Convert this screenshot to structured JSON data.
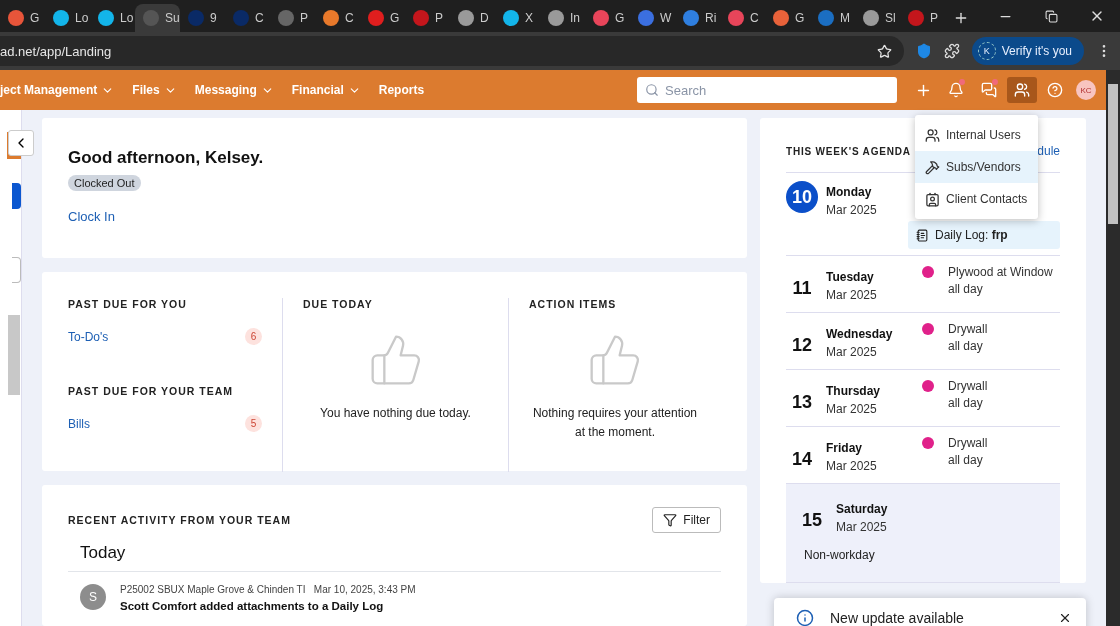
{
  "browser": {
    "tabs": [
      {
        "title": "G",
        "color": "#e8553a",
        "selected": false
      },
      {
        "title": "Lo",
        "color": "#13b5ea",
        "selected": false
      },
      {
        "title": "Lo",
        "color": "#13b5ea",
        "selected": false
      },
      {
        "title": "Su",
        "color": "#555555",
        "selected": true
      },
      {
        "title": "9",
        "color": "#0a2a66",
        "selected": false
      },
      {
        "title": "C",
        "color": "#0a2a66",
        "selected": false
      },
      {
        "title": "P",
        "color": "#666666",
        "selected": false
      },
      {
        "title": "C",
        "color": "#e8792b",
        "selected": false
      },
      {
        "title": "G",
        "color": "#e01e1e",
        "selected": false
      },
      {
        "title": "P",
        "color": "#c4161c",
        "selected": false
      },
      {
        "title": "D",
        "color": "#9a9a9a",
        "selected": false
      },
      {
        "title": "X",
        "color": "#13b5ea",
        "selected": false
      },
      {
        "title": "In",
        "color": "#9a9a9a",
        "selected": false
      },
      {
        "title": "G",
        "color": "#e8455a",
        "selected": false
      },
      {
        "title": "W",
        "color": "#3b6fe0",
        "selected": false
      },
      {
        "title": "Ri",
        "color": "#2f7fe0",
        "selected": false
      },
      {
        "title": "C",
        "color": "#e8455a",
        "selected": false
      },
      {
        "title": "G",
        "color": "#e8623a",
        "selected": false
      },
      {
        "title": "M",
        "color": "#1b6ec2",
        "selected": false
      },
      {
        "title": "Sl",
        "color": "#9a9a9a",
        "selected": false
      },
      {
        "title": "P",
        "color": "#c4161c",
        "selected": false
      }
    ],
    "url": "ad.net/app/Landing",
    "profile_button": "Verify it's you",
    "profile_initial": "K"
  },
  "nav": {
    "menus": [
      {
        "label": "ject Management",
        "has_menu": true
      },
      {
        "label": "Files",
        "has_menu": true
      },
      {
        "label": "Messaging",
        "has_menu": true
      },
      {
        "label": "Financial",
        "has_menu": true
      },
      {
        "label": "Reports",
        "has_menu": false
      }
    ],
    "search_placeholder": "Search",
    "icons": [
      {
        "kind": "add",
        "badge": false,
        "selected": false
      },
      {
        "kind": "bell",
        "badge": true,
        "selected": false
      },
      {
        "kind": "chat",
        "badge": true,
        "selected": false
      },
      {
        "kind": "people",
        "badge": false,
        "selected": true
      },
      {
        "kind": "help",
        "badge": false,
        "selected": false
      }
    ],
    "avatar": "KC"
  },
  "people_menu": [
    {
      "kind": "internal",
      "label": "Internal Users",
      "selected": false
    },
    {
      "kind": "vendors",
      "label": "Subs/Vendors",
      "selected": true
    },
    {
      "kind": "contacts",
      "label": "Client Contacts",
      "selected": false
    }
  ],
  "greeting": {
    "title": "Good afternoon, Kelsey.",
    "status": "Clocked Out",
    "action": "Clock In"
  },
  "summary": [
    {
      "kind": "list",
      "sections": [
        {
          "heading": "PAST DUE FOR YOU",
          "items": [
            {
              "label": "To-Do's",
              "count": "6"
            }
          ]
        },
        {
          "heading": "PAST DUE FOR YOUR TEAM",
          "items": [
            {
              "label": "Bills",
              "count": "5"
            }
          ]
        }
      ]
    },
    {
      "kind": "empty",
      "heading": "DUE TODAY",
      "message": "You have nothing due today."
    },
    {
      "kind": "empty",
      "heading": "ACTION ITEMS",
      "message": "Nothing requires your attention at the moment."
    }
  ],
  "activity": {
    "title": "RECENT ACTIVITY FROM YOUR TEAM",
    "filter": "Filter",
    "group": "Today",
    "items": [
      {
        "initial": "S",
        "project": "P25002 SBUX Maple Grove & Chinden TI",
        "time": "Mar 10, 2025, 3:43 PM",
        "text": "Scott Comfort added attachments to a Daily Log"
      }
    ]
  },
  "agenda": {
    "title": "THIS WEEK'S AGENDA",
    "link": "dule",
    "days": [
      {
        "number": "10",
        "weekday": "Monday",
        "month": "Mar 2025",
        "today": true,
        "workday": true,
        "logs": [
          "Daily Log: **frp**"
        ]
      },
      {
        "number": "11",
        "weekday": "Tuesday",
        "month": "Mar 2025",
        "today": false,
        "workday": true,
        "events": [
          {
            "title": "Plywood at Window",
            "time": "all day",
            "color": "#e0218a"
          }
        ]
      },
      {
        "number": "12",
        "weekday": "Wednesday",
        "month": "Mar 2025",
        "today": false,
        "workday": true,
        "events": [
          {
            "title": "Drywall",
            "time": "all day",
            "color": "#e0218a"
          }
        ]
      },
      {
        "number": "13",
        "weekday": "Thursday",
        "month": "Mar 2025",
        "today": false,
        "workday": true,
        "events": [
          {
            "title": "Drywall",
            "time": "all day",
            "color": "#e0218a"
          }
        ]
      },
      {
        "number": "14",
        "weekday": "Friday",
        "month": "Mar 2025",
        "today": false,
        "workday": true,
        "events": [
          {
            "title": "Drywall",
            "time": "all day",
            "color": "#e0218a"
          }
        ]
      },
      {
        "number": "15",
        "weekday": "Saturday",
        "month": "Mar 2025",
        "today": false,
        "workday": false,
        "note": "Non-workday"
      }
    ]
  },
  "toast": {
    "message": "New update available"
  }
}
